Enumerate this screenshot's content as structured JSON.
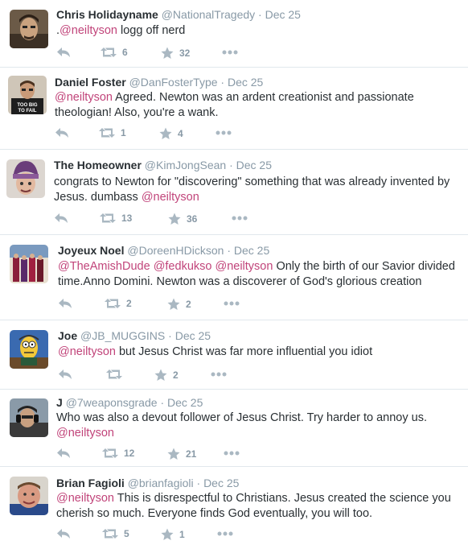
{
  "tweets": [
    {
      "name": "Chris Holidayname",
      "handle": "@NationalTragedy",
      "date": "Dec 25",
      "segments": [
        {
          "t": ".",
          "m": false
        },
        {
          "t": "@neiltyson",
          "m": true
        },
        {
          "t": " logg off nerd",
          "m": false
        }
      ],
      "retweets": "6",
      "favorites": "32",
      "avatar_color": "#5b4a3a"
    },
    {
      "name": "Daniel Foster",
      "handle": "@DanFosterType",
      "date": "Dec 25",
      "segments": [
        {
          "t": "@neiltyson",
          "m": true
        },
        {
          "t": " Agreed. Newton was an ardent creationist and passionate theologian! Also, you're a wank.",
          "m": false
        }
      ],
      "retweets": "1",
      "favorites": "4",
      "avatar_color": "#2b2b2b"
    },
    {
      "name": "The Homeowner",
      "handle": "@KimJongSean",
      "date": "Dec 25",
      "segments": [
        {
          "t": "congrats to Newton for \"discovering\" something that was already invented by Jesus. dumbass ",
          "m": false
        },
        {
          "t": "@neiltyson",
          "m": true
        }
      ],
      "retweets": "13",
      "favorites": "36",
      "avatar_color": "#6a3d7a"
    },
    {
      "name": "Joyeux Noel",
      "handle": "@DoreenHDickson",
      "date": "Dec 25",
      "segments": [
        {
          "t": "@TheAmishDude",
          "m": true
        },
        {
          "t": " ",
          "m": false
        },
        {
          "t": "@fedkukso",
          "m": true
        },
        {
          "t": " ",
          "m": false
        },
        {
          "t": "@neiltyson",
          "m": true
        },
        {
          "t": " Only the birth of our Savior divided time.Anno Domini. Newton was a discoverer of God's glorious creation",
          "m": false
        }
      ],
      "retweets": "2",
      "favorites": "2",
      "avatar_color": "#7a2a3a"
    },
    {
      "name": "Joe",
      "handle": "@JB_MUGGINS",
      "date": "Dec 25",
      "segments": [
        {
          "t": "@neiltyson",
          "m": true
        },
        {
          "t": " but Jesus Christ was far more influential you idiot",
          "m": false
        }
      ],
      "retweets": "",
      "favorites": "2",
      "avatar_color": "#e8c23a"
    },
    {
      "name": "J",
      "handle": "@7weaponsgrade",
      "date": "Dec 25",
      "segments": [
        {
          "t": "Who was also a devout follower of Jesus Christ. Try harder to annoy us. ",
          "m": false
        },
        {
          "t": "@neiltyson",
          "m": true
        }
      ],
      "retweets": "12",
      "favorites": "21",
      "avatar_color": "#4a4a4a"
    },
    {
      "name": "Brian Fagioli",
      "handle": "@brianfagioli",
      "date": "Dec 25",
      "segments": [
        {
          "t": "@neiltyson",
          "m": true
        },
        {
          "t": " This is disrespectful to Christians. Jesus created the science you cherish so much. Everyone finds God eventually, you will too.",
          "m": false
        }
      ],
      "retweets": "5",
      "favorites": "1",
      "avatar_color": "#c98a7a"
    }
  ],
  "separator": "·"
}
